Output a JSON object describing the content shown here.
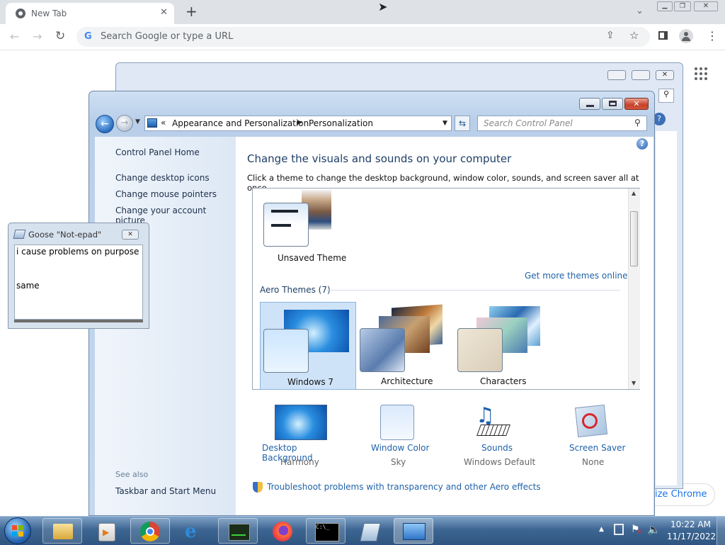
{
  "chrome": {
    "tab_title": "New Tab",
    "new_tab": "+",
    "omnibox_placeholder": "Search Google or type a URL",
    "customize_label": "ize Chrome"
  },
  "window": {
    "breadcrumb": {
      "prefix": "«",
      "items": [
        "Appearance and Personalization",
        "Personalization"
      ]
    },
    "search_placeholder": "Search Control Panel"
  },
  "left_pane": {
    "home": "Control Panel Home",
    "links": [
      "Change desktop icons",
      "Change mouse pointers",
      "Change your account picture"
    ],
    "see_also_title": "See also",
    "see_also": [
      "Taskbar and Start Menu"
    ]
  },
  "content": {
    "title": "Change the visuals and sounds on your computer",
    "subtitle": "Click a theme to change the desktop background, window color, sounds, and screen saver all at once.",
    "unsaved_theme": "Unsaved Theme",
    "get_more": "Get more themes online",
    "aero_heading": "Aero Themes (7)",
    "themes": [
      "Windows 7",
      "Architecture",
      "Characters"
    ],
    "settings": [
      {
        "label": "Desktop Background",
        "value": "Harmony"
      },
      {
        "label": "Window Color",
        "value": "Sky"
      },
      {
        "label": "Sounds",
        "value": "Windows Default"
      },
      {
        "label": "Screen Saver",
        "value": "None"
      }
    ],
    "troubleshoot": "Troubleshoot problems with transparency and other Aero effects"
  },
  "notepad": {
    "title": "Goose \"Not-epad\"",
    "lines": [
      "i cause problems on purpose",
      "same"
    ]
  },
  "taskbar": {
    "time": "10:22 AM",
    "date": "11/17/2022"
  },
  "colors": {
    "link": "#1f62a8",
    "title_blue": "#1e3f66",
    "taskbar": "#3e6693"
  }
}
